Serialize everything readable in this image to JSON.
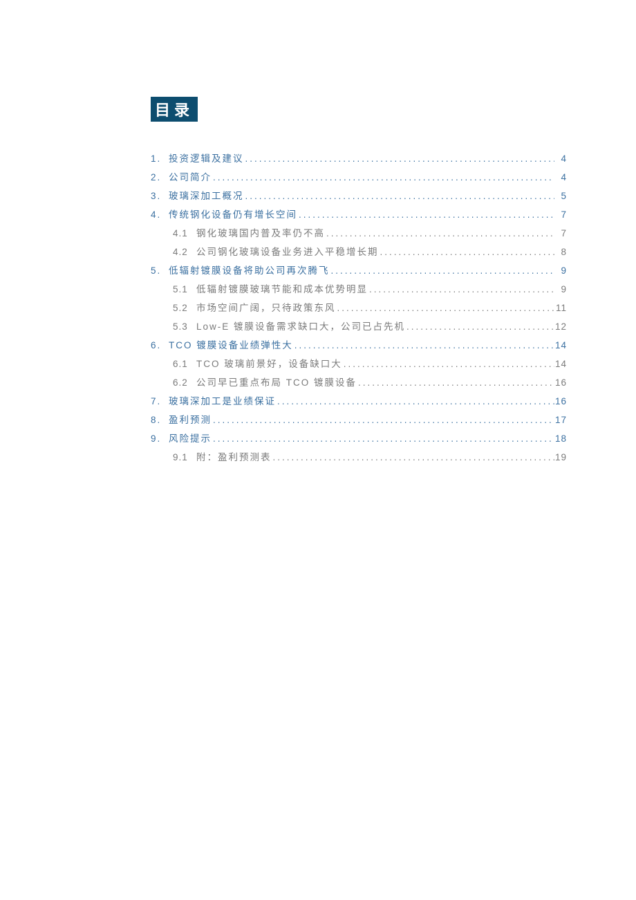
{
  "title": "目录",
  "toc": [
    {
      "level": 1,
      "num": "1.",
      "label": "投资逻辑及建议",
      "page": "4"
    },
    {
      "level": 1,
      "num": "2.",
      "label": "公司简介",
      "page": "4"
    },
    {
      "level": 1,
      "num": "3.",
      "label": "玻璃深加工概况",
      "page": "5"
    },
    {
      "level": 1,
      "num": "4.",
      "label": "传统钢化设备仍有增长空间",
      "page": "7"
    },
    {
      "level": 2,
      "num": "4.1",
      "label": "钢化玻璃国内普及率仍不高",
      "page": "7"
    },
    {
      "level": 2,
      "num": "4.2",
      "label": "公司钢化玻璃设备业务进入平稳增长期",
      "page": "8"
    },
    {
      "level": 1,
      "num": "5.",
      "label": "低辐射镀膜设备将助公司再次腾飞",
      "page": "9"
    },
    {
      "level": 2,
      "num": "5.1",
      "label": "低辐射镀膜玻璃节能和成本优势明显",
      "page": "9"
    },
    {
      "level": 2,
      "num": "5.2",
      "label": "市场空间广阔，只待政策东风",
      "page": "11"
    },
    {
      "level": 2,
      "num": "5.3",
      "label": "Low-E 镀膜设备需求缺口大，公司已占先机",
      "page": "12"
    },
    {
      "level": 1,
      "num": "6.",
      "label": "TCO 镀膜设备业绩弹性大",
      "page": "14"
    },
    {
      "level": 2,
      "num": "6.1",
      "label": "TCO 玻璃前景好，设备缺口大",
      "page": "14"
    },
    {
      "level": 2,
      "num": "6.2",
      "label": "公司早已重点布局 TCO 镀膜设备",
      "page": "16"
    },
    {
      "level": 1,
      "num": "7.",
      "label": "玻璃深加工是业绩保证",
      "page": "16"
    },
    {
      "level": 1,
      "num": "8.",
      "label": "盈利预测",
      "page": "17"
    },
    {
      "level": 1,
      "num": "9.",
      "label": "风险提示",
      "page": "18"
    },
    {
      "level": 2,
      "num": "9.1",
      "label": "附：盈利预测表",
      "page": "19"
    }
  ]
}
